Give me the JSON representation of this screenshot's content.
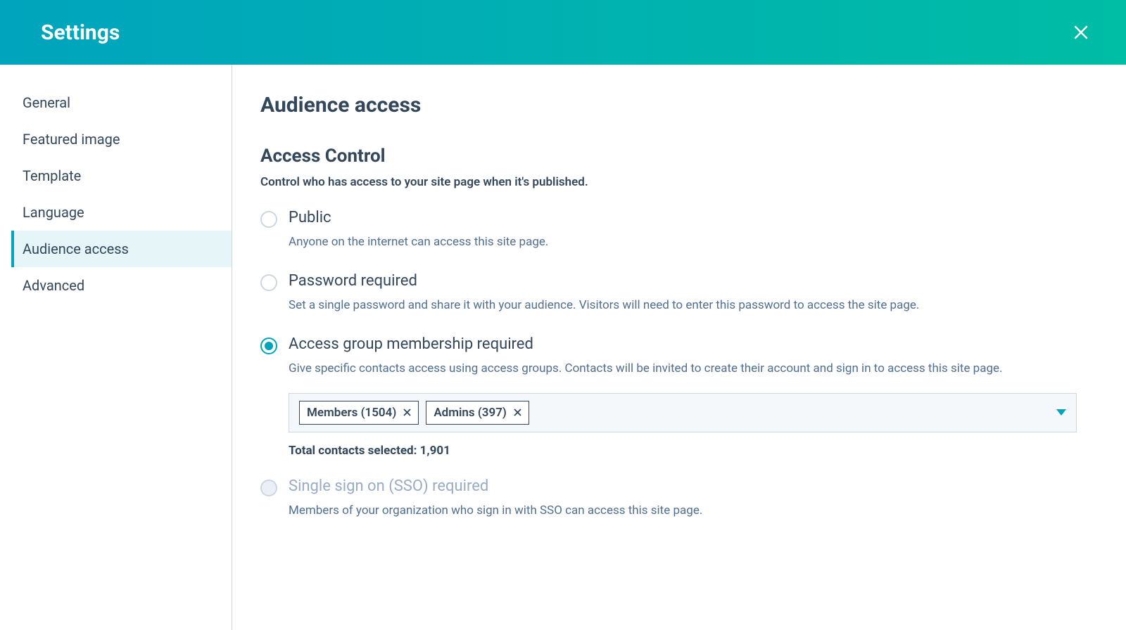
{
  "header": {
    "title": "Settings"
  },
  "sidebar": {
    "items": [
      {
        "label": "General"
      },
      {
        "label": "Featured image"
      },
      {
        "label": "Template"
      },
      {
        "label": "Language"
      },
      {
        "label": "Audience access"
      },
      {
        "label": "Advanced"
      }
    ]
  },
  "main": {
    "title": "Audience access",
    "section_title": "Access Control",
    "section_desc": "Control who has access to your site page when it's published.",
    "options": [
      {
        "label": "Public",
        "desc": "Anyone on the internet can access this site page."
      },
      {
        "label": "Password required",
        "desc": "Set a single password and share it with your audience. Visitors will need to enter this password to access the site page."
      },
      {
        "label": "Access group membership required",
        "desc": "Give specific contacts access using access groups. Contacts will be invited to create their account and sign in to access this site page."
      },
      {
        "label": "Single sign on (SSO) required",
        "desc": "Members of your organization who sign in with SSO can access this site page."
      }
    ],
    "tags": [
      {
        "label": "Members (1504)"
      },
      {
        "label": "Admins (397)"
      }
    ],
    "total_label": "Total contacts selected: 1,901"
  }
}
